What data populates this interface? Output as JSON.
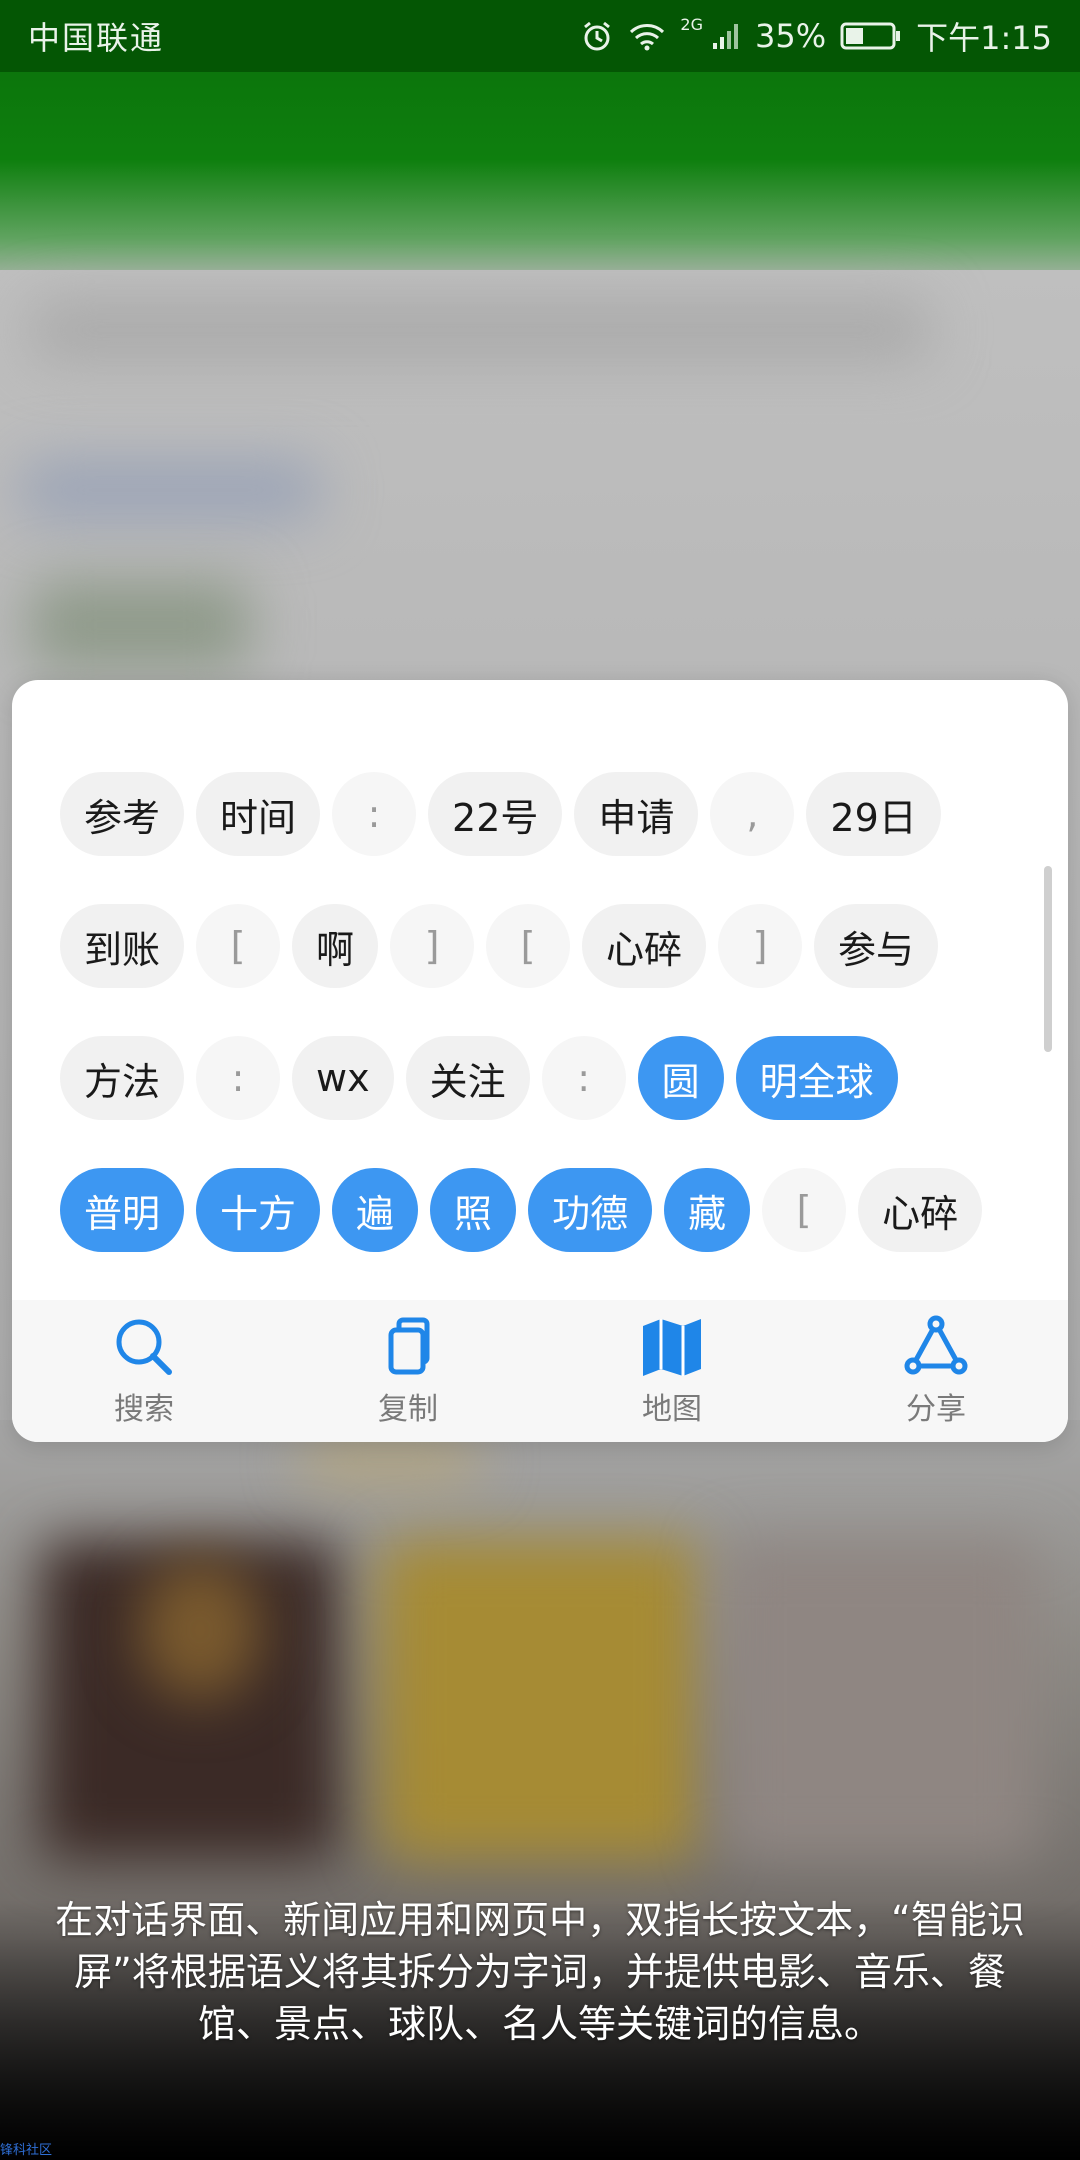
{
  "status_bar": {
    "carrier": "中国联通",
    "network": "2G",
    "battery": "35%",
    "time": "下午1:15",
    "icons": [
      "alarm-icon",
      "wifi-icon",
      "signal-icon",
      "battery-icon"
    ]
  },
  "smart_screen": {
    "rows": [
      [
        {
          "text": "参考",
          "kind": "word",
          "selected": false
        },
        {
          "text": "时间",
          "kind": "word",
          "selected": false
        },
        {
          "text": ":",
          "kind": "punct",
          "selected": false
        },
        {
          "text": "22号",
          "kind": "word",
          "selected": false
        },
        {
          "text": "申请",
          "kind": "word",
          "selected": false
        },
        {
          "text": ",",
          "kind": "punct",
          "selected": false
        },
        {
          "text": "29日",
          "kind": "word",
          "selected": false
        }
      ],
      [
        {
          "text": "到账",
          "kind": "word",
          "selected": false
        },
        {
          "text": "[",
          "kind": "punct",
          "selected": false
        },
        {
          "text": "啊",
          "kind": "word",
          "selected": false
        },
        {
          "text": "]",
          "kind": "punct",
          "selected": false
        },
        {
          "text": "[",
          "kind": "punct",
          "selected": false
        },
        {
          "text": "心碎",
          "kind": "word",
          "selected": false
        },
        {
          "text": "]",
          "kind": "punct",
          "selected": false
        },
        {
          "text": "参与",
          "kind": "word",
          "selected": false
        }
      ],
      [
        {
          "text": "方法",
          "kind": "word",
          "selected": false
        },
        {
          "text": ":",
          "kind": "punct",
          "selected": false
        },
        {
          "text": "wx",
          "kind": "word",
          "selected": false
        },
        {
          "text": "关注",
          "kind": "word",
          "selected": false
        },
        {
          "text": ":",
          "kind": "punct",
          "selected": false
        },
        {
          "text": "圆",
          "kind": "word",
          "selected": true
        },
        {
          "text": "明全球",
          "kind": "word",
          "selected": true
        }
      ],
      [
        {
          "text": "普明",
          "kind": "word",
          "selected": true
        },
        {
          "text": "十方",
          "kind": "word",
          "selected": true
        },
        {
          "text": "遍",
          "kind": "word",
          "selected": true
        },
        {
          "text": "照",
          "kind": "word",
          "selected": true
        },
        {
          "text": "功德",
          "kind": "word",
          "selected": true
        },
        {
          "text": "藏",
          "kind": "word",
          "selected": true
        },
        {
          "text": "[",
          "kind": "punct",
          "selected": false
        },
        {
          "text": "心碎",
          "kind": "word",
          "selected": false
        }
      ]
    ],
    "actions": [
      {
        "label": "搜索",
        "icon": "search-icon"
      },
      {
        "label": "复制",
        "icon": "copy-icon"
      },
      {
        "label": "地图",
        "icon": "map-icon"
      },
      {
        "label": "分享",
        "icon": "share-icon"
      }
    ],
    "colors": {
      "selected": "#3d97f2",
      "icon": "#1f86e8"
    }
  },
  "caption": "在对话界面、新闻应用和网页中，双指长按文本，“智能识屏”将根据语义将其拆分为字词，并提供电影、音乐、餐馆、景点、球队、名人等关键词的信息。",
  "watermark": "锋科社区"
}
